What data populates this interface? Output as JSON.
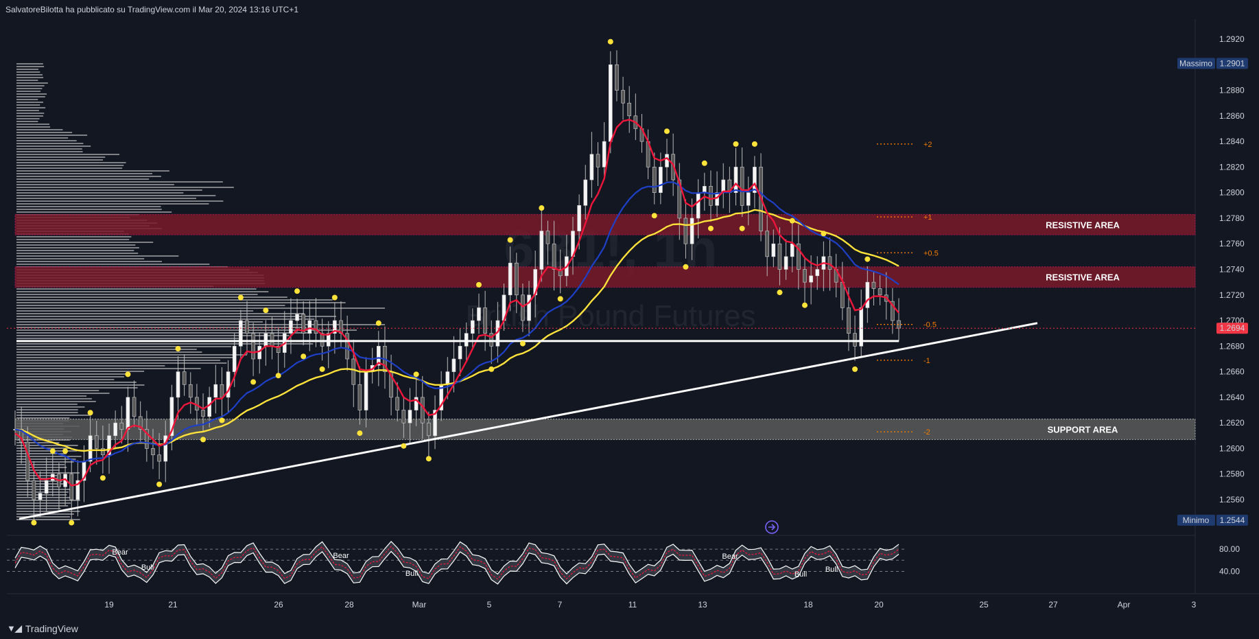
{
  "header": {
    "publisher_line": "SalvatoreBilotta ha pubblicato su TradingView.com il Mar 20, 2024 13:16 UTC+1"
  },
  "watermark": {
    "symbol": "6B1!, 1h",
    "name": "British Pound Futures"
  },
  "footer": {
    "brand": "TradingView",
    "logo_icon": "tradingview-logo-icon"
  },
  "colors": {
    "background": "#131722",
    "ema_fast": "#f0163a",
    "ema_mid": "#1e40c8",
    "ema_slow": "#ffe23a",
    "resistive_zone": "#7a1a2b",
    "support_zone": "#5a5a5a",
    "price_badge": "#f23645",
    "max_badge": "#1e3a6e",
    "fib": "#f57c00",
    "pivot": "#ffe23a"
  },
  "chart_data": {
    "type": "candlestick",
    "y_axis": {
      "ticks": [
        "1.2920",
        "1.2900",
        "1.2880",
        "1.2860",
        "1.2840",
        "1.2820",
        "1.2800",
        "1.2780",
        "1.2760",
        "1.2740",
        "1.2720",
        "1.2700",
        "1.2680",
        "1.2660",
        "1.2640",
        "1.2620",
        "1.2600",
        "1.2580",
        "1.2560"
      ],
      "range": [
        1.2535,
        1.2935
      ]
    },
    "x_axis": {
      "ticks": [
        "19",
        "21",
        "26",
        "28",
        "Mar",
        "5",
        "7",
        "11",
        "13",
        "18",
        "20",
        "25",
        "27",
        "Apr",
        "3"
      ]
    },
    "badges": {
      "max_label": "Massimo",
      "max_value": "1.2901",
      "max_price": 1.2901,
      "min_label": "Minimo",
      "min_value": "1.2544",
      "min_price": 1.2544,
      "last_value": "1.2694",
      "last_price": 1.2694
    },
    "zones": [
      {
        "label": "RESISTIVE AREA",
        "top": 1.2783,
        "bottom": 1.2767,
        "kind": "resistive"
      },
      {
        "label": "RESISTIVE AREA",
        "top": 1.2742,
        "bottom": 1.2726,
        "kind": "resistive"
      },
      {
        "label": "SUPPORT AREA",
        "top": 1.2623,
        "bottom": 1.2607,
        "kind": "support"
      }
    ],
    "horizontal_level": 1.2684,
    "trendline": {
      "start": [
        0.0,
        1.2545
      ],
      "end": [
        1.0,
        1.2698
      ]
    },
    "fib_levels": [
      {
        "label": "+2",
        "price": 1.2838
      },
      {
        "label": "+1",
        "price": 1.2781
      },
      {
        "label": "+0.5",
        "price": 1.2753
      },
      {
        "label": "-0.5",
        "price": 1.2697
      },
      {
        "label": "-1",
        "price": 1.2669
      },
      {
        "label": "-2",
        "price": 1.2613
      }
    ],
    "series_close": [
      1.2615,
      1.2605,
      1.2575,
      1.256,
      1.2565,
      1.2575,
      1.258,
      1.257,
      1.258,
      1.256,
      1.2575,
      1.259,
      1.261,
      1.26,
      1.2595,
      1.261,
      1.262,
      1.2615,
      1.264,
      1.2625,
      1.2615,
      1.26,
      1.2595,
      1.259,
      1.261,
      1.264,
      1.266,
      1.265,
      1.264,
      1.263,
      1.2625,
      1.264,
      1.265,
      1.264,
      1.266,
      1.268,
      1.27,
      1.269,
      1.267,
      1.268,
      1.269,
      1.268,
      1.2675,
      1.269,
      1.27,
      1.2705,
      1.269,
      1.27,
      1.269,
      1.268,
      1.269,
      1.27,
      1.269,
      1.267,
      1.265,
      1.263,
      1.266,
      1.2665,
      1.268,
      1.266,
      1.264,
      1.263,
      1.262,
      1.263,
      1.264,
      1.262,
      1.261,
      1.263,
      1.265,
      1.266,
      1.267,
      1.268,
      1.269,
      1.27,
      1.271,
      1.269,
      1.268,
      1.27,
      1.272,
      1.2745,
      1.272,
      1.27,
      1.272,
      1.274,
      1.277,
      1.276,
      1.274,
      1.2735,
      1.275,
      1.277,
      1.279,
      1.281,
      1.283,
      1.282,
      1.284,
      1.29,
      1.288,
      1.287,
      1.286,
      1.285,
      1.284,
      1.282,
      1.28,
      1.282,
      1.283,
      1.281,
      1.278,
      1.276,
      1.278,
      1.28,
      1.2805,
      1.279,
      1.28,
      1.281,
      1.28,
      1.282,
      1.279,
      1.28,
      1.282,
      1.277,
      1.275,
      1.276,
      1.274,
      1.275,
      1.276,
      1.274,
      1.273,
      1.2735,
      1.274,
      1.275,
      1.274,
      1.273,
      1.271,
      1.269,
      1.268,
      1.271,
      1.273,
      1.2725,
      1.272,
      1.2715,
      1.27,
      1.2694
    ],
    "ema_fast": [
      1.2612,
      1.2608,
      1.2596,
      1.2583,
      1.2576,
      1.2576,
      1.2577,
      1.2575,
      1.2576,
      1.2571,
      1.2572,
      1.2577,
      1.2587,
      1.259,
      1.2591,
      1.2597,
      1.2603,
      1.2606,
      1.2616,
      1.2618,
      1.2617,
      1.2612,
      1.2607,
      1.2602,
      1.2604,
      1.2614,
      1.2628,
      1.2634,
      1.2636,
      1.2634,
      1.2631,
      1.2634,
      1.2639,
      1.2639,
      1.2645,
      1.2656,
      1.267,
      1.2676,
      1.2675,
      1.2676,
      1.268,
      1.268,
      1.2679,
      1.2682,
      1.2688,
      1.2693,
      1.2692,
      1.2694,
      1.2693,
      1.2689,
      1.2689,
      1.2692,
      1.2691,
      1.2685,
      1.2675,
      1.2662,
      1.2661,
      1.2662,
      1.2667,
      1.2665,
      1.2657,
      1.2649,
      1.264,
      1.2637,
      1.2638,
      1.2633,
      1.2626,
      1.2627,
      1.2634,
      1.2642,
      1.265,
      1.2659,
      1.2668,
      1.2678,
      1.2688,
      1.2689,
      1.2687,
      1.2691,
      1.27,
      1.2714,
      1.2716,
      1.2711,
      1.2714,
      1.2721,
      1.2735,
      1.2742,
      1.2741,
      1.2739,
      1.2742,
      1.275,
      1.2762,
      1.2776,
      1.2791,
      1.2799,
      1.2811,
      1.2839,
      1.2851,
      1.2856,
      1.2857,
      1.2855,
      1.285,
      1.284,
      1.2827,
      1.2825,
      1.2827,
      1.2822,
      1.2808,
      1.2792,
      1.2789,
      1.2793,
      1.2797,
      1.2795,
      1.2796,
      1.2801,
      1.2801,
      1.2807,
      1.2802,
      1.2802,
      1.2807,
      1.2796,
      1.2784,
      1.2778,
      1.2767,
      1.2762,
      1.2761,
      1.2756,
      1.2749,
      1.2745,
      1.2743,
      1.2745,
      1.2744,
      1.274,
      1.2731,
      1.2719,
      1.2708,
      1.2709,
      1.2716,
      1.2719,
      1.2719,
      1.2718,
      1.2712,
      1.2706
    ]
  }
}
